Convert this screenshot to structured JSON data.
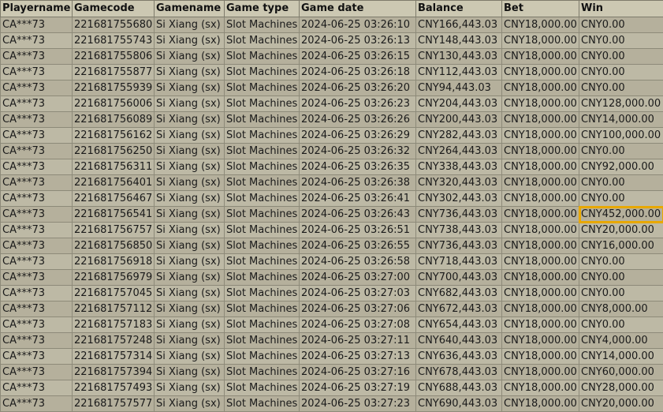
{
  "columns": [
    "Playername",
    "Gamecode",
    "Gamename",
    "Game type",
    "Game date",
    "Balance",
    "Bet",
    "Win"
  ],
  "highlight": {
    "row": 12,
    "col": 7,
    "color": "#e8a800"
  },
  "rows": [
    [
      "CA***73",
      "221681755680",
      "Si Xiang (sx)",
      "Slot Machines",
      "2024-06-25 03:26:10",
      "CNY166,443.03",
      "CNY18,000.00",
      "CNY0.00"
    ],
    [
      "CA***73",
      "221681755743",
      "Si Xiang (sx)",
      "Slot Machines",
      "2024-06-25 03:26:13",
      "CNY148,443.03",
      "CNY18,000.00",
      "CNY0.00"
    ],
    [
      "CA***73",
      "221681755806",
      "Si Xiang (sx)",
      "Slot Machines",
      "2024-06-25 03:26:15",
      "CNY130,443.03",
      "CNY18,000.00",
      "CNY0.00"
    ],
    [
      "CA***73",
      "221681755877",
      "Si Xiang (sx)",
      "Slot Machines",
      "2024-06-25 03:26:18",
      "CNY112,443.03",
      "CNY18,000.00",
      "CNY0.00"
    ],
    [
      "CA***73",
      "221681755939",
      "Si Xiang (sx)",
      "Slot Machines",
      "2024-06-25 03:26:20",
      "CNY94,443.03",
      "CNY18,000.00",
      "CNY0.00"
    ],
    [
      "CA***73",
      "221681756006",
      "Si Xiang (sx)",
      "Slot Machines",
      "2024-06-25 03:26:23",
      "CNY204,443.03",
      "CNY18,000.00",
      "CNY128,000.00"
    ],
    [
      "CA***73",
      "221681756089",
      "Si Xiang (sx)",
      "Slot Machines",
      "2024-06-25 03:26:26",
      "CNY200,443.03",
      "CNY18,000.00",
      "CNY14,000.00"
    ],
    [
      "CA***73",
      "221681756162",
      "Si Xiang (sx)",
      "Slot Machines",
      "2024-06-25 03:26:29",
      "CNY282,443.03",
      "CNY18,000.00",
      "CNY100,000.00"
    ],
    [
      "CA***73",
      "221681756250",
      "Si Xiang (sx)",
      "Slot Machines",
      "2024-06-25 03:26:32",
      "CNY264,443.03",
      "CNY18,000.00",
      "CNY0.00"
    ],
    [
      "CA***73",
      "221681756311",
      "Si Xiang (sx)",
      "Slot Machines",
      "2024-06-25 03:26:35",
      "CNY338,443.03",
      "CNY18,000.00",
      "CNY92,000.00"
    ],
    [
      "CA***73",
      "221681756401",
      "Si Xiang (sx)",
      "Slot Machines",
      "2024-06-25 03:26:38",
      "CNY320,443.03",
      "CNY18,000.00",
      "CNY0.00"
    ],
    [
      "CA***73",
      "221681756467",
      "Si Xiang (sx)",
      "Slot Machines",
      "2024-06-25 03:26:41",
      "CNY302,443.03",
      "CNY18,000.00",
      "CNY0.00"
    ],
    [
      "CA***73",
      "221681756541",
      "Si Xiang (sx)",
      "Slot Machines",
      "2024-06-25 03:26:43",
      "CNY736,443.03",
      "CNY18,000.00",
      "CNY452,000.00"
    ],
    [
      "CA***73",
      "221681756757",
      "Si Xiang (sx)",
      "Slot Machines",
      "2024-06-25 03:26:51",
      "CNY738,443.03",
      "CNY18,000.00",
      "CNY20,000.00"
    ],
    [
      "CA***73",
      "221681756850",
      "Si Xiang (sx)",
      "Slot Machines",
      "2024-06-25 03:26:55",
      "CNY736,443.03",
      "CNY18,000.00",
      "CNY16,000.00"
    ],
    [
      "CA***73",
      "221681756918",
      "Si Xiang (sx)",
      "Slot Machines",
      "2024-06-25 03:26:58",
      "CNY718,443.03",
      "CNY18,000.00",
      "CNY0.00"
    ],
    [
      "CA***73",
      "221681756979",
      "Si Xiang (sx)",
      "Slot Machines",
      "2024-06-25 03:27:00",
      "CNY700,443.03",
      "CNY18,000.00",
      "CNY0.00"
    ],
    [
      "CA***73",
      "221681757045",
      "Si Xiang (sx)",
      "Slot Machines",
      "2024-06-25 03:27:03",
      "CNY682,443.03",
      "CNY18,000.00",
      "CNY0.00"
    ],
    [
      "CA***73",
      "221681757112",
      "Si Xiang (sx)",
      "Slot Machines",
      "2024-06-25 03:27:06",
      "CNY672,443.03",
      "CNY18,000.00",
      "CNY8,000.00"
    ],
    [
      "CA***73",
      "221681757183",
      "Si Xiang (sx)",
      "Slot Machines",
      "2024-06-25 03:27:08",
      "CNY654,443.03",
      "CNY18,000.00",
      "CNY0.00"
    ],
    [
      "CA***73",
      "221681757248",
      "Si Xiang (sx)",
      "Slot Machines",
      "2024-06-25 03:27:11",
      "CNY640,443.03",
      "CNY18,000.00",
      "CNY4,000.00"
    ],
    [
      "CA***73",
      "221681757314",
      "Si Xiang (sx)",
      "Slot Machines",
      "2024-06-25 03:27:13",
      "CNY636,443.03",
      "CNY18,000.00",
      "CNY14,000.00"
    ],
    [
      "CA***73",
      "221681757394",
      "Si Xiang (sx)",
      "Slot Machines",
      "2024-06-25 03:27:16",
      "CNY678,443.03",
      "CNY18,000.00",
      "CNY60,000.00"
    ],
    [
      "CA***73",
      "221681757493",
      "Si Xiang (sx)",
      "Slot Machines",
      "2024-06-25 03:27:19",
      "CNY688,443.03",
      "CNY18,000.00",
      "CNY28,000.00"
    ],
    [
      "CA***73",
      "221681757577",
      "Si Xiang (sx)",
      "Slot Machines",
      "2024-06-25 03:27:23",
      "CNY690,443.03",
      "CNY18,000.00",
      "CNY20,000.00"
    ]
  ]
}
